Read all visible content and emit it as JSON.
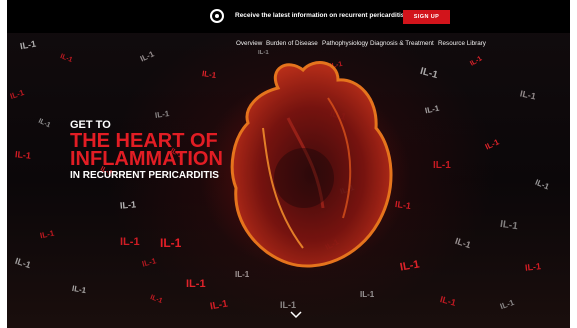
{
  "banner": {
    "message": "Receive the latest information on recurrent pericarditis.",
    "signup_label": "SIGN UP"
  },
  "nav": {
    "items": [
      "Overview",
      "Burden of Disease",
      "Pathophysiology",
      "Diagnosis & Treatment",
      "Resource Library"
    ]
  },
  "hero": {
    "line1": "GET TO",
    "line2": "THE HEART OF",
    "line3": "INFLAMMATION",
    "line4": "IN RECURRENT PERICARDITIS"
  },
  "decor": {
    "tag": "IL-1"
  },
  "colors": {
    "accent": "#e21d24",
    "signup": "#d2141b",
    "background": "#0a0708"
  },
  "icons": {
    "logo": "circle-logo-icon",
    "scroll": "chevron-down-icon"
  }
}
